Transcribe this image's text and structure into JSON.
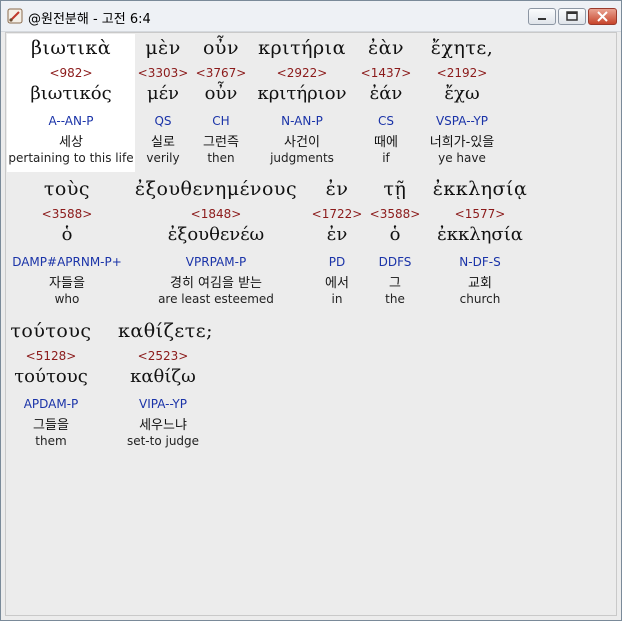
{
  "window": {
    "title": "@원전분해 - 고전 6:4",
    "icon": "scroll-icon",
    "controls": [
      "minimize-icon",
      "maximize-icon",
      "close-icon"
    ]
  },
  "lines": [
    [
      {
        "greek": "βιωτικὰ",
        "num": "<982>",
        "lemma": "βιωτικός",
        "parse": "A--AN-P",
        "ko": "세상",
        "en": "pertaining to this life",
        "highlight": true
      },
      {
        "greek": "μὲν",
        "num": "<3303>",
        "lemma": "μέν",
        "parse": "QS",
        "ko": "실로",
        "en": "verily"
      },
      {
        "greek": "οὖν",
        "num": "<3767>",
        "lemma": "οὖν",
        "parse": "CH",
        "ko": "그런즉",
        "en": "then"
      },
      {
        "greek": "κριτήρια",
        "num": "<2922>",
        "lemma": "κριτήριον",
        "parse": "N-AN-P",
        "ko": "사건이",
        "en": "judgments"
      },
      {
        "greek": "ἐὰν",
        "num": "<1437>",
        "lemma": "ἐάν",
        "parse": "CS",
        "ko": "때에",
        "en": "if"
      },
      {
        "greek": "ἔχητε,",
        "num": "<2192>",
        "lemma": "ἔχω",
        "parse": "VSPA--YP",
        "ko": "너희가-있을",
        "en": "ye have"
      }
    ],
    [
      {
        "greek": "τοὺς",
        "num": "<3588>",
        "lemma": "ὁ",
        "parse": "DAMP#APRNM-P+",
        "ko": "자들을",
        "en": "who"
      },
      {
        "greek": "ἐξουθενημένους",
        "num": "<1848>",
        "lemma": "ἐξουθενέω",
        "parse": "VPRPAM-P",
        "ko": "경히 여김을 받는",
        "en": "are least esteemed"
      },
      {
        "greek": "ἐν",
        "num": "<1722>",
        "lemma": "ἐν",
        "parse": "PD",
        "ko": "에서",
        "en": "in"
      },
      {
        "greek": "τῇ",
        "num": "<3588>",
        "lemma": "ὁ",
        "parse": "DDFS",
        "ko": "그",
        "en": "the"
      },
      {
        "greek": "ἐκκλησίᾳ",
        "num": "<1577>",
        "lemma": "ἐκκλησία",
        "parse": "N-DF-S",
        "ko": "교회",
        "en": "church"
      }
    ],
    [
      {
        "greek": "τούτους",
        "num": "<5128>",
        "lemma": "τούτους",
        "parse": "APDAM-P",
        "ko": "그들을",
        "en": "them"
      },
      {
        "greek": "καθίζετε;",
        "num": "<2523>",
        "lemma": "καθίζω",
        "parse": "VIPA--YP",
        "ko": "세우느냐",
        "en": "set-to judge"
      }
    ]
  ]
}
